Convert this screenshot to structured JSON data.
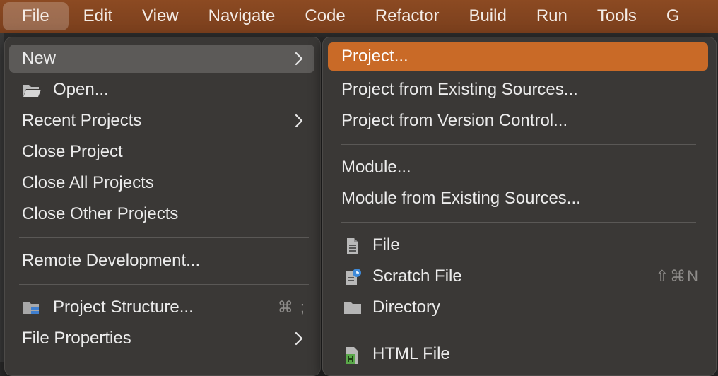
{
  "menubar": {
    "items": [
      "File",
      "Edit",
      "View",
      "Navigate",
      "Code",
      "Refactor",
      "Build",
      "Run",
      "Tools",
      "G"
    ]
  },
  "file_menu": {
    "items": {
      "new": "New",
      "open": "Open...",
      "recent_projects": "Recent Projects",
      "close_project": "Close Project",
      "close_all_projects": "Close All Projects",
      "close_other_projects": "Close Other Projects",
      "remote_development": "Remote Development...",
      "project_structure": "Project Structure...",
      "project_structure_shortcut": "⌘ ;",
      "file_properties": "File Properties"
    }
  },
  "new_menu": {
    "items": {
      "project": "Project...",
      "project_from_existing_sources": "Project from Existing Sources...",
      "project_from_version_control": "Project from Version Control...",
      "module": "Module...",
      "module_from_existing_sources": "Module from Existing Sources...",
      "file": "File",
      "scratch_file": "Scratch File",
      "scratch_file_shortcut": "⇧⌘N",
      "directory": "Directory",
      "html_file": "HTML File"
    }
  },
  "colors": {
    "menubar_bg": "#8c4a22",
    "menu_bg": "#3a3836",
    "highlight_orange": "#c96a27",
    "highlight_gray": "#5c5a58"
  },
  "icons": {
    "open": "folder-open-icon",
    "project_structure": "project-structure-icon",
    "file": "file-icon",
    "scratch_file": "scratch-file-icon",
    "directory": "folder-icon",
    "html_file": "html-file-icon",
    "submenu": "chevron-right-icon"
  }
}
